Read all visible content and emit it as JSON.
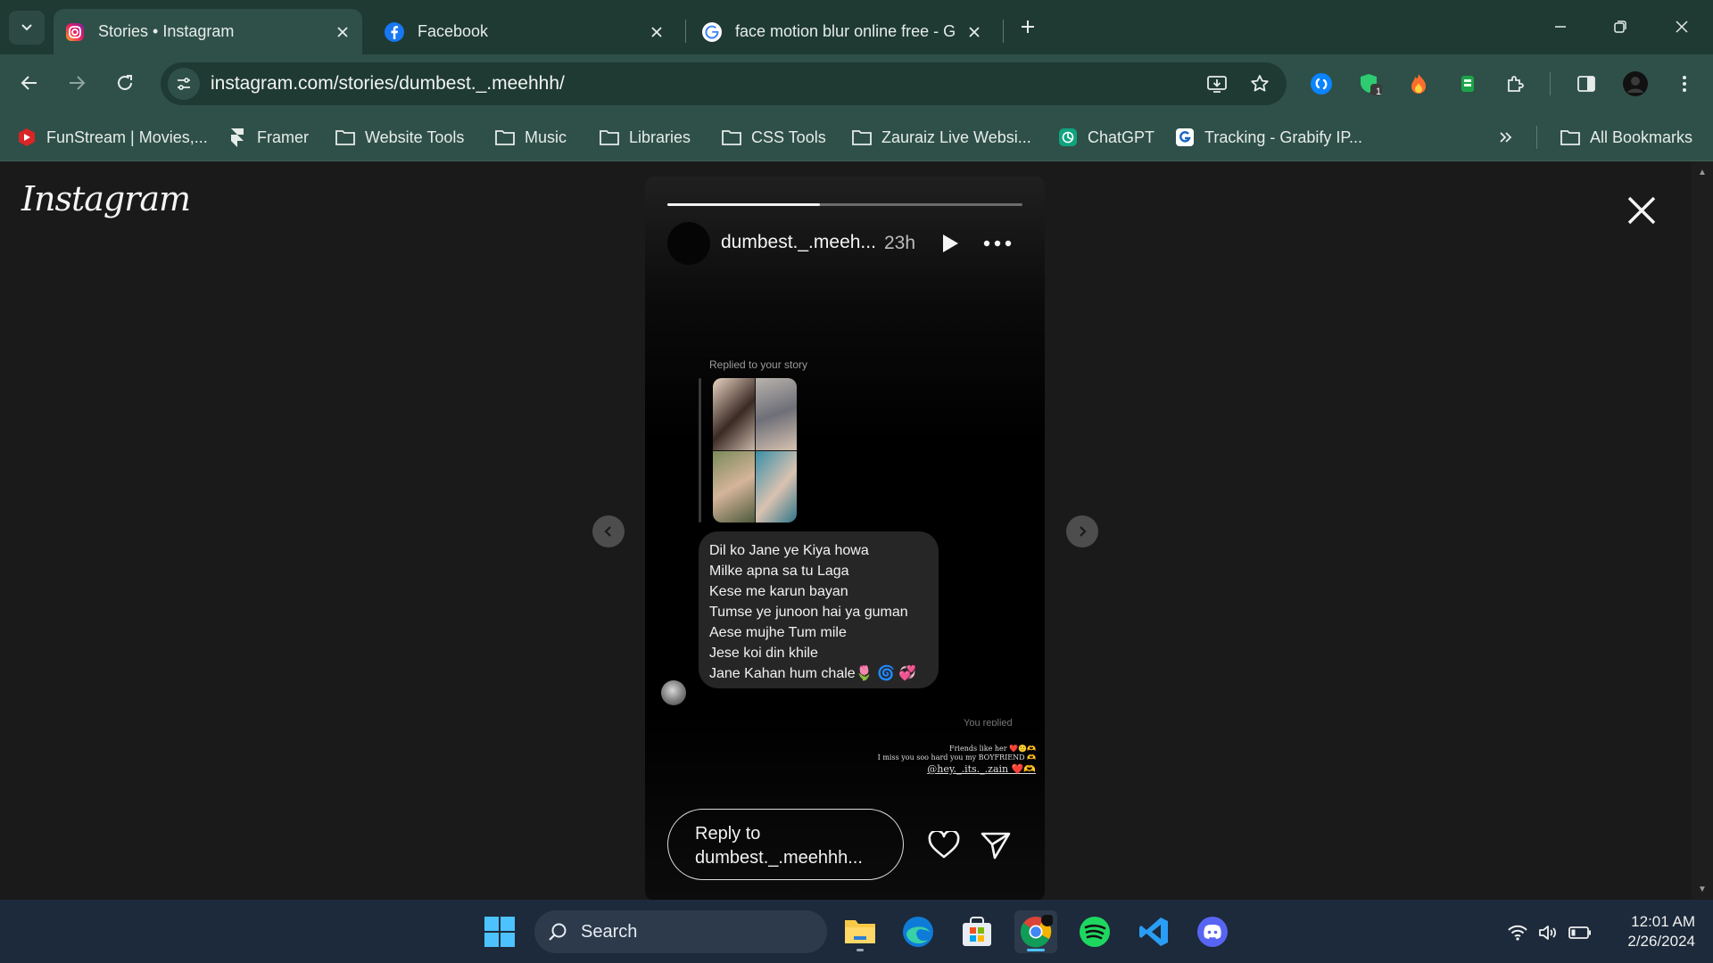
{
  "browser": {
    "tabs": [
      {
        "title": "Stories • Instagram",
        "favicon": "instagram-icon",
        "active": true
      },
      {
        "title": "Facebook",
        "favicon": "facebook-icon",
        "active": false
      },
      {
        "title": "face motion blur online free - G",
        "favicon": "google-icon",
        "active": false
      }
    ],
    "url": "instagram.com/stories/dumbest._.meehhh/",
    "bookmarks": [
      {
        "label": "FunStream | Movies,...",
        "icon": "funstream-icon"
      },
      {
        "label": "Framer",
        "icon": "framer-icon"
      },
      {
        "label": "Website Tools",
        "icon": "folder-icon"
      },
      {
        "label": "Music",
        "icon": "folder-icon"
      },
      {
        "label": "Libraries",
        "icon": "folder-icon"
      },
      {
        "label": "CSS Tools",
        "icon": "folder-icon"
      },
      {
        "label": "Zauraiz Live Websi...",
        "icon": "folder-icon"
      },
      {
        "label": "ChatGPT",
        "icon": "chatgpt-icon"
      },
      {
        "label": "Tracking - Grabify IP...",
        "icon": "grabify-icon"
      }
    ],
    "all_bookmarks_label": "All Bookmarks",
    "extension_badge": "1"
  },
  "page": {
    "logo": "Instagram",
    "story": {
      "progress": 0.43,
      "username": "dumbest._.meeh...",
      "time": "23h",
      "replied_label": "Replied to your story",
      "message_lines": [
        "Dil ko Jane ye Kiya howa",
        "Milke apna sa tu Laga",
        "Kese me karun bayan",
        "Tumse ye junoon hai ya guman",
        "Aese mujhe Tum mile",
        "Jese koi din khile",
        "Jane Kahan hum chale🌷 🌀 💞"
      ],
      "you_replied": "You replied",
      "caption_line1": "Friends like her ❤️🙂🫶",
      "caption_line2": "I miss you soo hard you my BOYFRIEND 🫶",
      "caption_tag": "@hey._.its._.zain ❤️🫶",
      "reply_placeholder_line1": "Reply to",
      "reply_placeholder_line2": "dumbest._.meehhh..."
    }
  },
  "taskbar": {
    "search_label": "Search",
    "time": "12:01 AM",
    "date": "2/26/2024"
  },
  "colors": {
    "tabbar": "#1f3a33",
    "toolbar": "#2f5048",
    "page_bg": "#1a1a1a",
    "taskbar": "#1c2a3b"
  }
}
